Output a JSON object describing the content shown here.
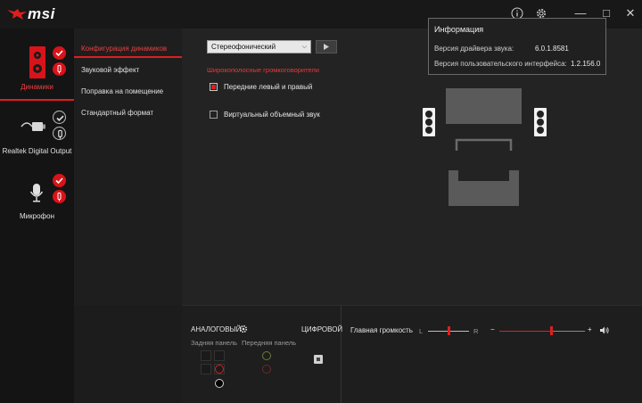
{
  "app": {
    "brand": "msi"
  },
  "titlebar": {
    "info_icon": "info-icon",
    "settings_icon": "gear-icon",
    "minimize": "—",
    "maximize": "□",
    "close": "✕"
  },
  "devices": [
    {
      "name": "speakers",
      "label": "Динамики",
      "active": true,
      "checked": true
    },
    {
      "name": "digital-output",
      "label": "Realtek Digital Output",
      "active": false,
      "checked": false
    },
    {
      "name": "microphone",
      "label": "Микрофон",
      "active": false,
      "checked": true
    }
  ],
  "menu": {
    "items": [
      {
        "label": "Конфигурация динамиков",
        "active": true
      },
      {
        "label": "Звуковой эффект",
        "active": false
      },
      {
        "label": "Поправка на помещение",
        "active": false
      },
      {
        "label": "Стандартный формат",
        "active": false
      }
    ]
  },
  "speaker_config": {
    "selected": "Стереофонический",
    "section_label": "Широкополосные громкоговорители",
    "options": [
      {
        "label": "Передние левый и правый",
        "checked": true
      },
      {
        "label": "Виртуальный объемный звук",
        "checked": false
      }
    ]
  },
  "info": {
    "title": "Информация",
    "driver_label": "Версия драйвера звука:",
    "driver_value": "6.0.1.8581",
    "ui_label": "Версия пользовательского интерфейса:",
    "ui_value": "1.2.156.0"
  },
  "connectors": {
    "analog_label": "АНАЛОГОВЫЙ",
    "digital_label": "ЦИФРОВОЙ",
    "rear_label": "Задняя панель",
    "front_label": "Передняя панель"
  },
  "volume": {
    "label": "Главная громкость",
    "left": "L",
    "right": "R",
    "minus": "−",
    "plus": "+",
    "balance": 0.5,
    "level": 0.6
  },
  "colors": {
    "accent": "#e01e1e",
    "background": "#1c1c1c"
  }
}
